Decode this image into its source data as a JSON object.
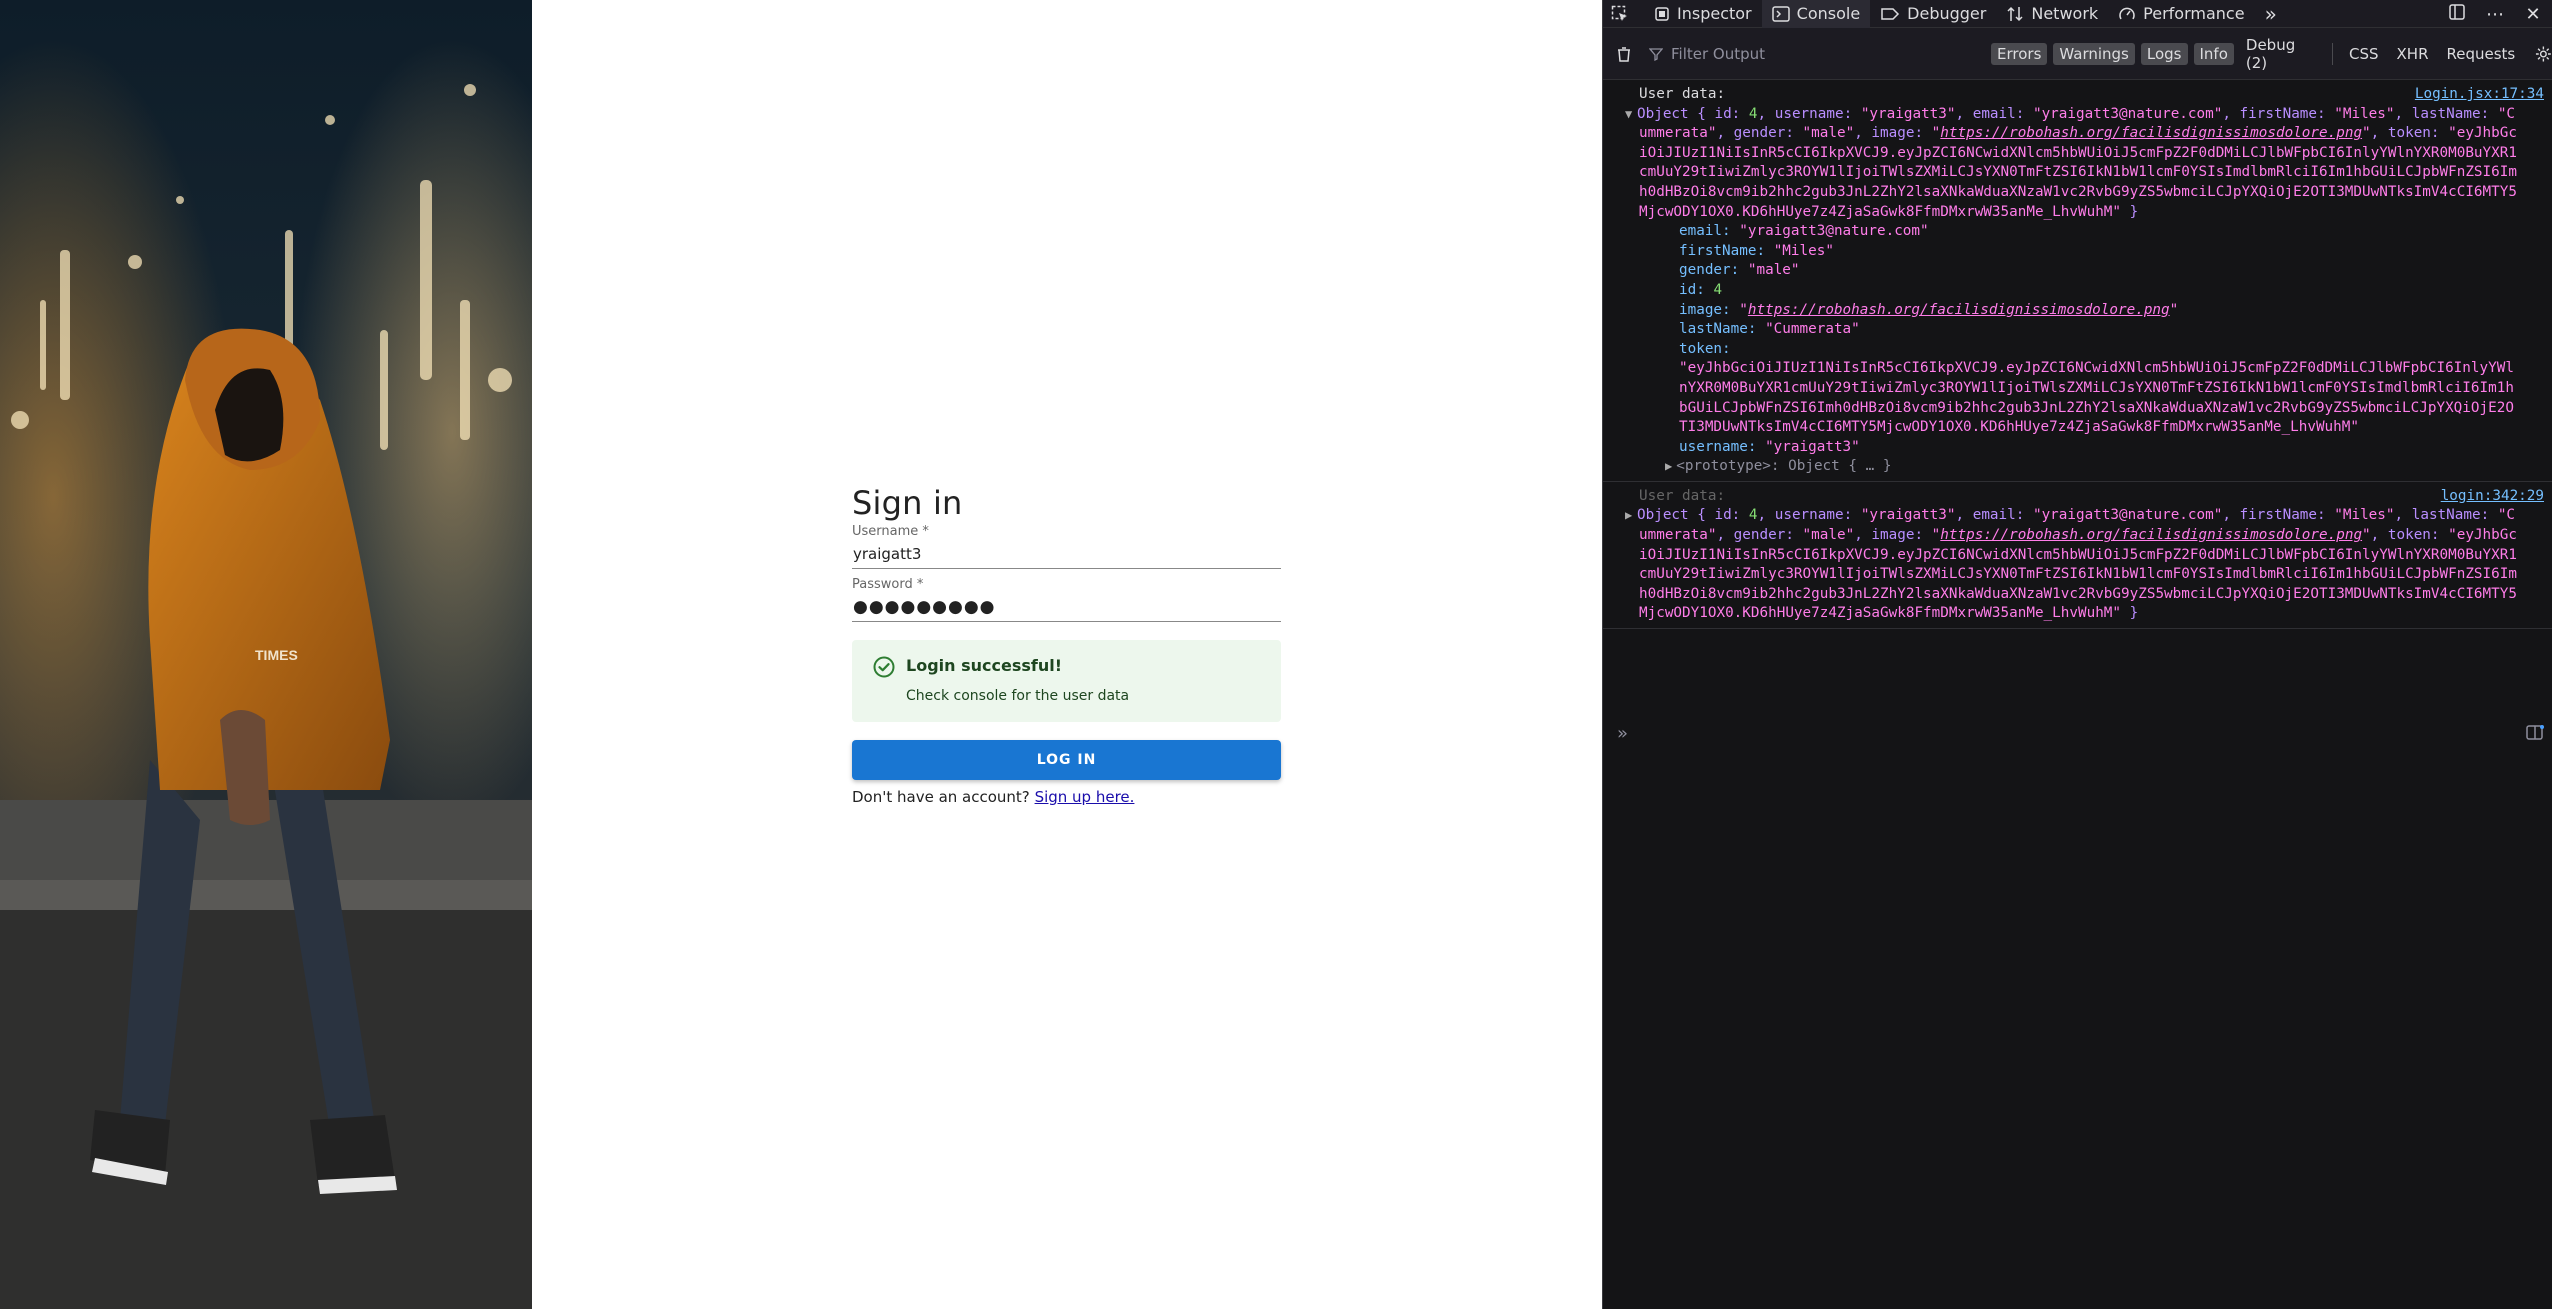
{
  "login": {
    "title": "Sign in",
    "username_label": "Username *",
    "username_value": "yraigatt3",
    "password_label": "Password *",
    "password_value": "●●●●●●●●●",
    "alert_title": "Login successful!",
    "alert_body": "Check console for the user data",
    "button_label": "LOG IN",
    "signup_prompt": "Don't have an account?",
    "signup_link": "Sign up here."
  },
  "devtools": {
    "tabs": [
      "Inspector",
      "Console",
      "Debugger",
      "Network",
      "Performance"
    ],
    "filter_placeholder": "Filter Output",
    "filters": [
      "Errors",
      "Warnings",
      "Logs",
      "Info",
      "Debug (2)"
    ],
    "request_filters": [
      "CSS",
      "XHR",
      "Requests"
    ],
    "messages": [
      {
        "label": "User data:",
        "source": "Login.jsx:17:34",
        "summary_open": "Object { ",
        "id": "4",
        "username": "\"yraigatt3\"",
        "email": "\"yraigatt3@nature.com\"",
        "firstName": "\"Miles\"",
        "lastName": "\"Cummerata\"",
        "gender": "\"male\"",
        "image": "\"https://robohash.org/facilisdignissimosdolore.png\"",
        "image_url": "https://robohash.org/facilisdignissimosdolore.png",
        "token": "\"eyJhbGciOiJIUzI1NiIsInR5cCI6IkpXVCJ9.eyJpZCI6NCwidXNlcm5hbWUiOiJ5cmFpZ2F0dDMiLCJlbWFpbCI6InlyYWlnYXR0M0BuYXR1cmUuY29tIiwiZmlyc3ROYW1lIjoiTWlsZXMiLCJsYXN0TmFtZSI6IkN1bW1lcmF0YSIsImdlbmRlciI6Im1hbGUiLCJpbWFnZSI6Imh0dHBzOi8vcm9ib2hhc2gub3JnL2ZhY2lsaXNkaWduaXNzaW1vc2RvbG9yZS5wbmciLCJpYXQiOjE2OTI3MDUwNTksImV4cCI6MTY5MjcwODY1OX0.KD6hHUye7z4ZjaSaGwk8FfmDMxrwW35anMe_LhvWuhM\"",
        "prototype": "<prototype>: Object { … }"
      },
      {
        "label": "User data:",
        "source": "login:342:29"
      }
    ]
  },
  "colors": {
    "primary": "#1976d2",
    "success_bg": "#edf7ed",
    "success_text": "#1e4620",
    "devtools_bg": "#141416"
  }
}
